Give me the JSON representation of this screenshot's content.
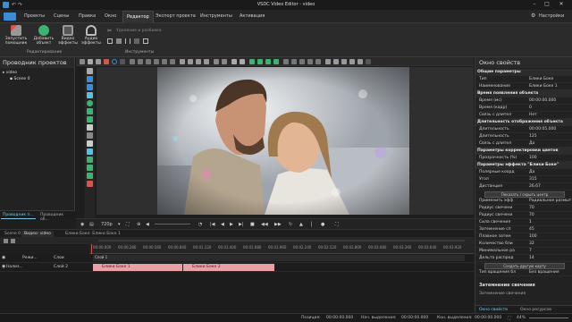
{
  "window": {
    "title": "VSDC Video Editor - video",
    "settings_label": "Настройки"
  },
  "menu": {
    "items": [
      "Проекты",
      "Сцены",
      "Правка",
      "Окно",
      "Редактор",
      "Экспорт проекта",
      "Инструменты",
      "Активация"
    ],
    "active_index": 4
  },
  "ribbon": {
    "buttons": [
      "Запустить помощник",
      "Добавить объект",
      "Видео эффекты",
      "Аудио эффекты"
    ],
    "group_edit_label": "Редактирование",
    "group_tools_label": "Инструменты",
    "tools_hint": "Удаление и разбивка"
  },
  "project_explorer": {
    "title": "Проводник проектов",
    "items": [
      "video",
      "Scene 0"
    ],
    "tabs": [
      "Проводник п...",
      "Проводник об..."
    ]
  },
  "preview": {
    "quality": "720p",
    "zoom": "44%"
  },
  "timeline": {
    "tabs": [
      "Scene 0",
      "Видео: video",
      "Блики Боке: Блики Боке 1"
    ],
    "active_tab": 1,
    "ruler_ticks": [
      "00:00.000",
      "00:00.280",
      "00:00.560",
      "00:00.840",
      "00:01.120",
      "00:01.400",
      "00:01.680",
      "00:01.960",
      "00:02.240",
      "00:02.520",
      "00:02.800",
      "00:03.080",
      "00:03.360",
      "00:03.640",
      "00:03.920"
    ],
    "track_header": [
      "Режи...",
      "Слои"
    ],
    "track_row": [
      "Нализ...",
      "Слой 2"
    ],
    "clips": [
      "Блики Боке 1",
      "Блики Боке 2"
    ],
    "layer_label": "Слой 1"
  },
  "properties": {
    "title": "Окно свойств",
    "rows": [
      {
        "type": "section",
        "k": "Общие параметры"
      },
      {
        "k": "Тип",
        "v": "Блики Боке"
      },
      {
        "k": "Наименование",
        "v": "Блики Боке 1"
      },
      {
        "type": "section",
        "k": "Время появления объекта"
      },
      {
        "k": "Время (мс)",
        "v": "00:00:00.000"
      },
      {
        "k": "Время (кадр)",
        "v": "0"
      },
      {
        "k": "Связь с длител",
        "v": "Нет"
      },
      {
        "type": "section",
        "k": "Длительность отображения объекта"
      },
      {
        "k": "Длительность",
        "v": "00:00:05.000"
      },
      {
        "k": "Длительность",
        "v": "125"
      },
      {
        "k": "Связь с длител",
        "v": "Да"
      },
      {
        "type": "section",
        "k": "Параметры корректировки цветов"
      },
      {
        "k": "Прозрачность (%)",
        "v": "100"
      },
      {
        "type": "section",
        "k": "Параметры эффекта \"Блики Боке\""
      },
      {
        "k": "Полярные коорд",
        "v": "Да"
      },
      {
        "k": "Угол",
        "v": "315"
      },
      {
        "k": "Дистанция",
        "v": "26.67"
      },
      {
        "type": "button",
        "k": "Показать / скрыть центр"
      },
      {
        "k": "Применить эфф",
        "v": "Радиальное размыт"
      },
      {
        "k": "Радиус свечени",
        "v": "70"
      },
      {
        "k": "Радиус свечени",
        "v": "70"
      },
      {
        "k": "Сила свечения",
        "v": "1"
      },
      {
        "k": "Затемнение сп",
        "v": "45"
      },
      {
        "k": "Плавное затем",
        "v": "100"
      },
      {
        "k": "Количество бли",
        "v": "32"
      },
      {
        "k": "Минимальное ра",
        "v": "7"
      },
      {
        "k": "Дельта распред",
        "v": "14"
      },
      {
        "type": "button",
        "k": "Создать другую карту"
      },
      {
        "k": "Тип вращения бл",
        "v": "Без вращения"
      }
    ],
    "footer_title": "Затемнение свечения",
    "footer_desc": "Затемнение свечения",
    "bottom_tabs": [
      "Окно свойств",
      "Окно ресурсов"
    ]
  },
  "status": {
    "position_label": "Позиция:",
    "position_value": "00:00:00.000",
    "start_label": "Нач. выделения:",
    "start_value": "00:00:00.000",
    "end_label": "Кон. выделения:",
    "end_value": "00:00:00.000",
    "zoom": "44%"
  }
}
